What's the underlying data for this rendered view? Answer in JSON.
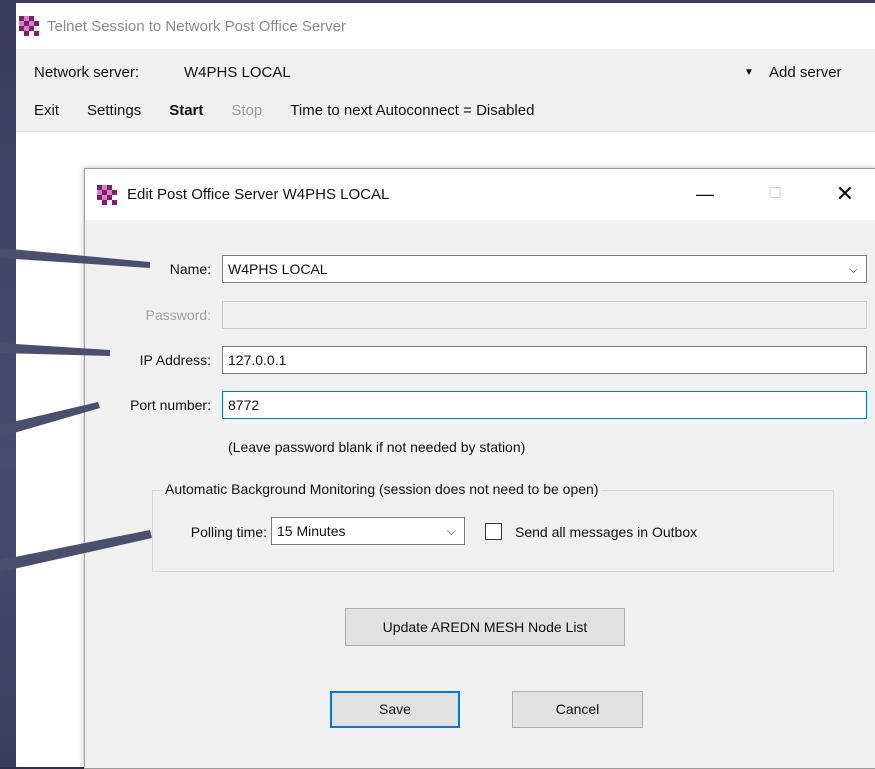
{
  "main_window": {
    "title": "Telnet Session to Network Post Office Server",
    "server_label": "Network server:",
    "server_value": "W4PHS LOCAL",
    "add_server_label": "Add server",
    "menu": {
      "exit": "Exit",
      "settings": "Settings",
      "start": "Start",
      "stop": "Stop",
      "autoconnect": "Time to next Autoconnect = Disabled"
    }
  },
  "dialog": {
    "title": "Edit Post Office Server W4PHS LOCAL",
    "name_label": "Name:",
    "name_value": "W4PHS LOCAL",
    "password_label": "Password:",
    "password_value": "",
    "ip_label": "IP Address:",
    "ip_value": "127.0.0.1",
    "port_label": "Port number:",
    "port_value": "8772",
    "password_hint": "(Leave password blank if not needed by station)",
    "group_label": "Automatic Background Monitoring (session does not need to be open)",
    "polling_label": "Polling time:",
    "polling_value": "15 Minutes",
    "send_all_label": "Send all messages in Outbox",
    "send_all_checked": false,
    "update_button": "Update AREDN MESH Node List",
    "save_button": "Save",
    "cancel_button": "Cancel"
  },
  "colors": {
    "background": "#2e2e4a",
    "pointer": "#4a4f6e",
    "focus_border": "#0078d7",
    "icon_purple": "#7b1f6e"
  },
  "icons": {
    "app_icon": "checkered-app-icon",
    "dialog_icon": "checkered-app-icon",
    "minimize": "minimize-icon",
    "maximize": "maximize-icon",
    "close": "close-icon",
    "dropdown": "chevron-down-icon"
  }
}
